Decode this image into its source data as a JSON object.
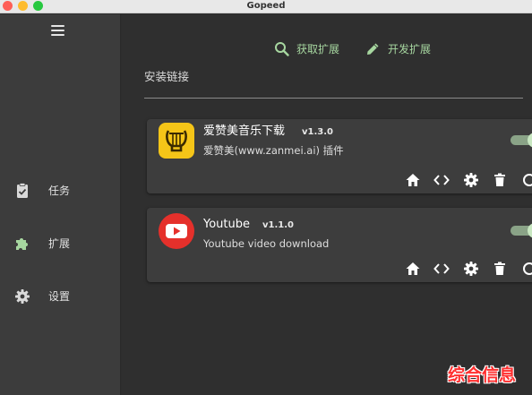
{
  "window": {
    "title": "Gopeed"
  },
  "sidebar": {
    "items": [
      {
        "label": "任务",
        "icon": "task-icon"
      },
      {
        "label": "扩展",
        "icon": "puzzle-icon"
      },
      {
        "label": "设置",
        "icon": "gear-icon"
      }
    ],
    "active_color": "#a7d7a0"
  },
  "toolbar": {
    "get_extensions_label": "获取扩展",
    "develop_extensions_label": "开发扩展"
  },
  "install": {
    "placeholder": "安装链接"
  },
  "extensions": [
    {
      "name": "爱赞美音乐下载",
      "version": "v1.3.0",
      "description": "爱赞美(www.zanmei.ai) 插件",
      "enabled": true,
      "logo": "lyre-icon"
    },
    {
      "name": "Youtube",
      "version": "v1.1.0",
      "description": "Youtube video download",
      "enabled": true,
      "logo": "youtube-icon"
    }
  ],
  "watermark": "综合信息",
  "colors": {
    "accent": "#a7d7a0",
    "card": "#3d3d3d",
    "background": "#2f2f2f"
  }
}
